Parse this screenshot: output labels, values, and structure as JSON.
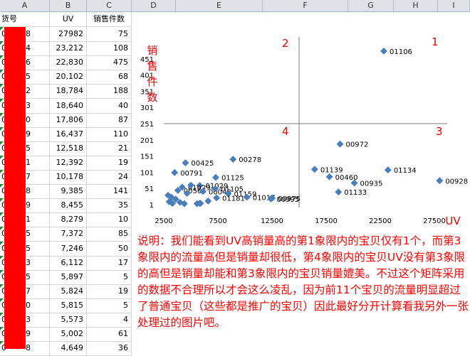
{
  "columns": [
    "A",
    "B",
    "C",
    "D",
    "E",
    "F",
    "G",
    "H",
    "I"
  ],
  "headers": {
    "a": "货号",
    "b": "UV",
    "c": "销售件数"
  },
  "rows": [
    {
      "a": "0",
      "a2": "8",
      "b": "27982",
      "c": "75"
    },
    {
      "a": "0",
      "a2": "4",
      "b": "23,212",
      "c": "108"
    },
    {
      "a": "0",
      "a2": "6",
      "b": "22,830",
      "c": "475"
    },
    {
      "a": "0",
      "a2": "5",
      "b": "20,102",
      "c": "68"
    },
    {
      "a": "0",
      "a2": "2",
      "b": "18,784",
      "c": "188"
    },
    {
      "a": "0",
      "a2": "3",
      "b": "18,640",
      "c": "40"
    },
    {
      "a": "0",
      "a2": "0",
      "b": "17,806",
      "c": "87"
    },
    {
      "a": "0",
      "a2": "9",
      "b": "16,437",
      "c": "110"
    },
    {
      "a": "0",
      "a2": "5",
      "b": "12,518",
      "c": "21"
    },
    {
      "a": "0",
      "a2": "1",
      "b": "12,392",
      "c": "19"
    },
    {
      "a": "0",
      "a2": "7",
      "b": "10,178",
      "c": "24"
    },
    {
      "a": "0",
      "a2": "8",
      "b": "9,385",
      "c": "141"
    },
    {
      "a": "0",
      "a2": "9",
      "b": "8,455",
      "c": "35"
    },
    {
      "a": "0",
      "a2": "1",
      "b": "8,279",
      "c": "10"
    },
    {
      "a": "0",
      "a2": "5",
      "b": "7,372",
      "c": "85"
    },
    {
      "a": "0",
      "a2": "5",
      "b": "7,246",
      "c": "50"
    },
    {
      "a": "0",
      "a2": "3",
      "b": "6,112",
      "c": "17"
    },
    {
      "a": "0",
      "a2": "5",
      "b": "5,897",
      "c": "5"
    },
    {
      "a": "0",
      "a2": "7",
      "b": "5,824",
      "c": "19"
    },
    {
      "a": "0",
      "a2": "0",
      "b": "5,815",
      "c": "5"
    },
    {
      "a": "0",
      "a2": "3",
      "b": "5,573",
      "c": "4"
    },
    {
      "a": "0",
      "a2": "9",
      "b": "5,002",
      "c": "61"
    },
    {
      "a": "0",
      "a2": "8",
      "b": "4,649",
      "c": "36"
    }
  ],
  "chart_data": {
    "type": "scatter",
    "ylabel": "销售件数",
    "xlabel": "UV",
    "xlim": [
      2500,
      30000
    ],
    "ylim": [
      1,
      501
    ],
    "xticks": [
      "2500",
      "7500",
      "12500",
      "17500",
      "22500",
      "27500"
    ],
    "yticks": [
      "1",
      "51",
      "101",
      "151",
      "201",
      "251",
      "301",
      "351",
      "401",
      "451"
    ],
    "quadrant_divider": {
      "x": 15000,
      "y": 251
    },
    "quadrants": [
      "1",
      "2",
      "3",
      "4"
    ],
    "points": [
      {
        "x": 22830,
        "y": 475,
        "label": "01106"
      },
      {
        "x": 18784,
        "y": 188,
        "label": "00972"
      },
      {
        "x": 8900,
        "y": 141,
        "label": "00278"
      },
      {
        "x": 4500,
        "y": 130,
        "label": "00425"
      },
      {
        "x": 3500,
        "y": 100,
        "label": "00791"
      },
      {
        "x": 7300,
        "y": 85,
        "label": "01125"
      },
      {
        "x": 16437,
        "y": 110,
        "label": "01139"
      },
      {
        "x": 23212,
        "y": 108,
        "label": "01134"
      },
      {
        "x": 17806,
        "y": 87,
        "label": "00460"
      },
      {
        "x": 20102,
        "y": 68,
        "label": "00935"
      },
      {
        "x": 27982,
        "y": 75,
        "label": "00928"
      },
      {
        "x": 18640,
        "y": 40,
        "label": "01133"
      },
      {
        "x": 5824,
        "y": 60,
        "label": "01029"
      },
      {
        "x": 4200,
        "y": 55,
        "label": "01029"
      },
      {
        "x": 3800,
        "y": 45,
        "label": "00566"
      },
      {
        "x": 6112,
        "y": 42,
        "label": "00048"
      },
      {
        "x": 7246,
        "y": 50,
        "label": "01105"
      },
      {
        "x": 8455,
        "y": 35,
        "label": "01159"
      },
      {
        "x": 7372,
        "y": 22,
        "label": "01181"
      },
      {
        "x": 10178,
        "y": 24,
        "label": "01017"
      },
      {
        "x": 12518,
        "y": 21,
        "label": "00975"
      },
      {
        "x": 12392,
        "y": 19,
        "label": "00995"
      },
      {
        "x": 3000,
        "y": 10,
        "label": ""
      },
      {
        "x": 3300,
        "y": 5,
        "label": ""
      },
      {
        "x": 3600,
        "y": 18,
        "label": ""
      },
      {
        "x": 4000,
        "y": 8,
        "label": ""
      },
      {
        "x": 4400,
        "y": 4,
        "label": ""
      },
      {
        "x": 4649,
        "y": 36,
        "label": ""
      },
      {
        "x": 5002,
        "y": 61,
        "label": ""
      },
      {
        "x": 5573,
        "y": 4,
        "label": ""
      },
      {
        "x": 5815,
        "y": 5,
        "label": ""
      },
      {
        "x": 5897,
        "y": 5,
        "label": ""
      },
      {
        "x": 6600,
        "y": 12,
        "label": ""
      },
      {
        "x": 2900,
        "y": 30,
        "label": ""
      },
      {
        "x": 3200,
        "y": 24,
        "label": ""
      }
    ]
  },
  "note": "说明：我们能看到UV高销量高的第1象限内的宝贝仅有1个，而第3象限内的流量高但是销量却很低，第4象限内的宝贝UV没有第3象限的高但是销量却能和第3象限内的宝贝销量媲美。不过这个矩阵采用的数据不合理所以才会这么凌乱，因为前11个宝贝的流量明显超过了普通宝贝（这些都是推广的宝贝）因此最好分开计算看我另外一张处理过的图片吧。",
  "colors": {
    "point": "#4a7ebb",
    "quad": "#e00000",
    "redbar": "#ff0000",
    "header_bg": "#dfe3e8"
  }
}
